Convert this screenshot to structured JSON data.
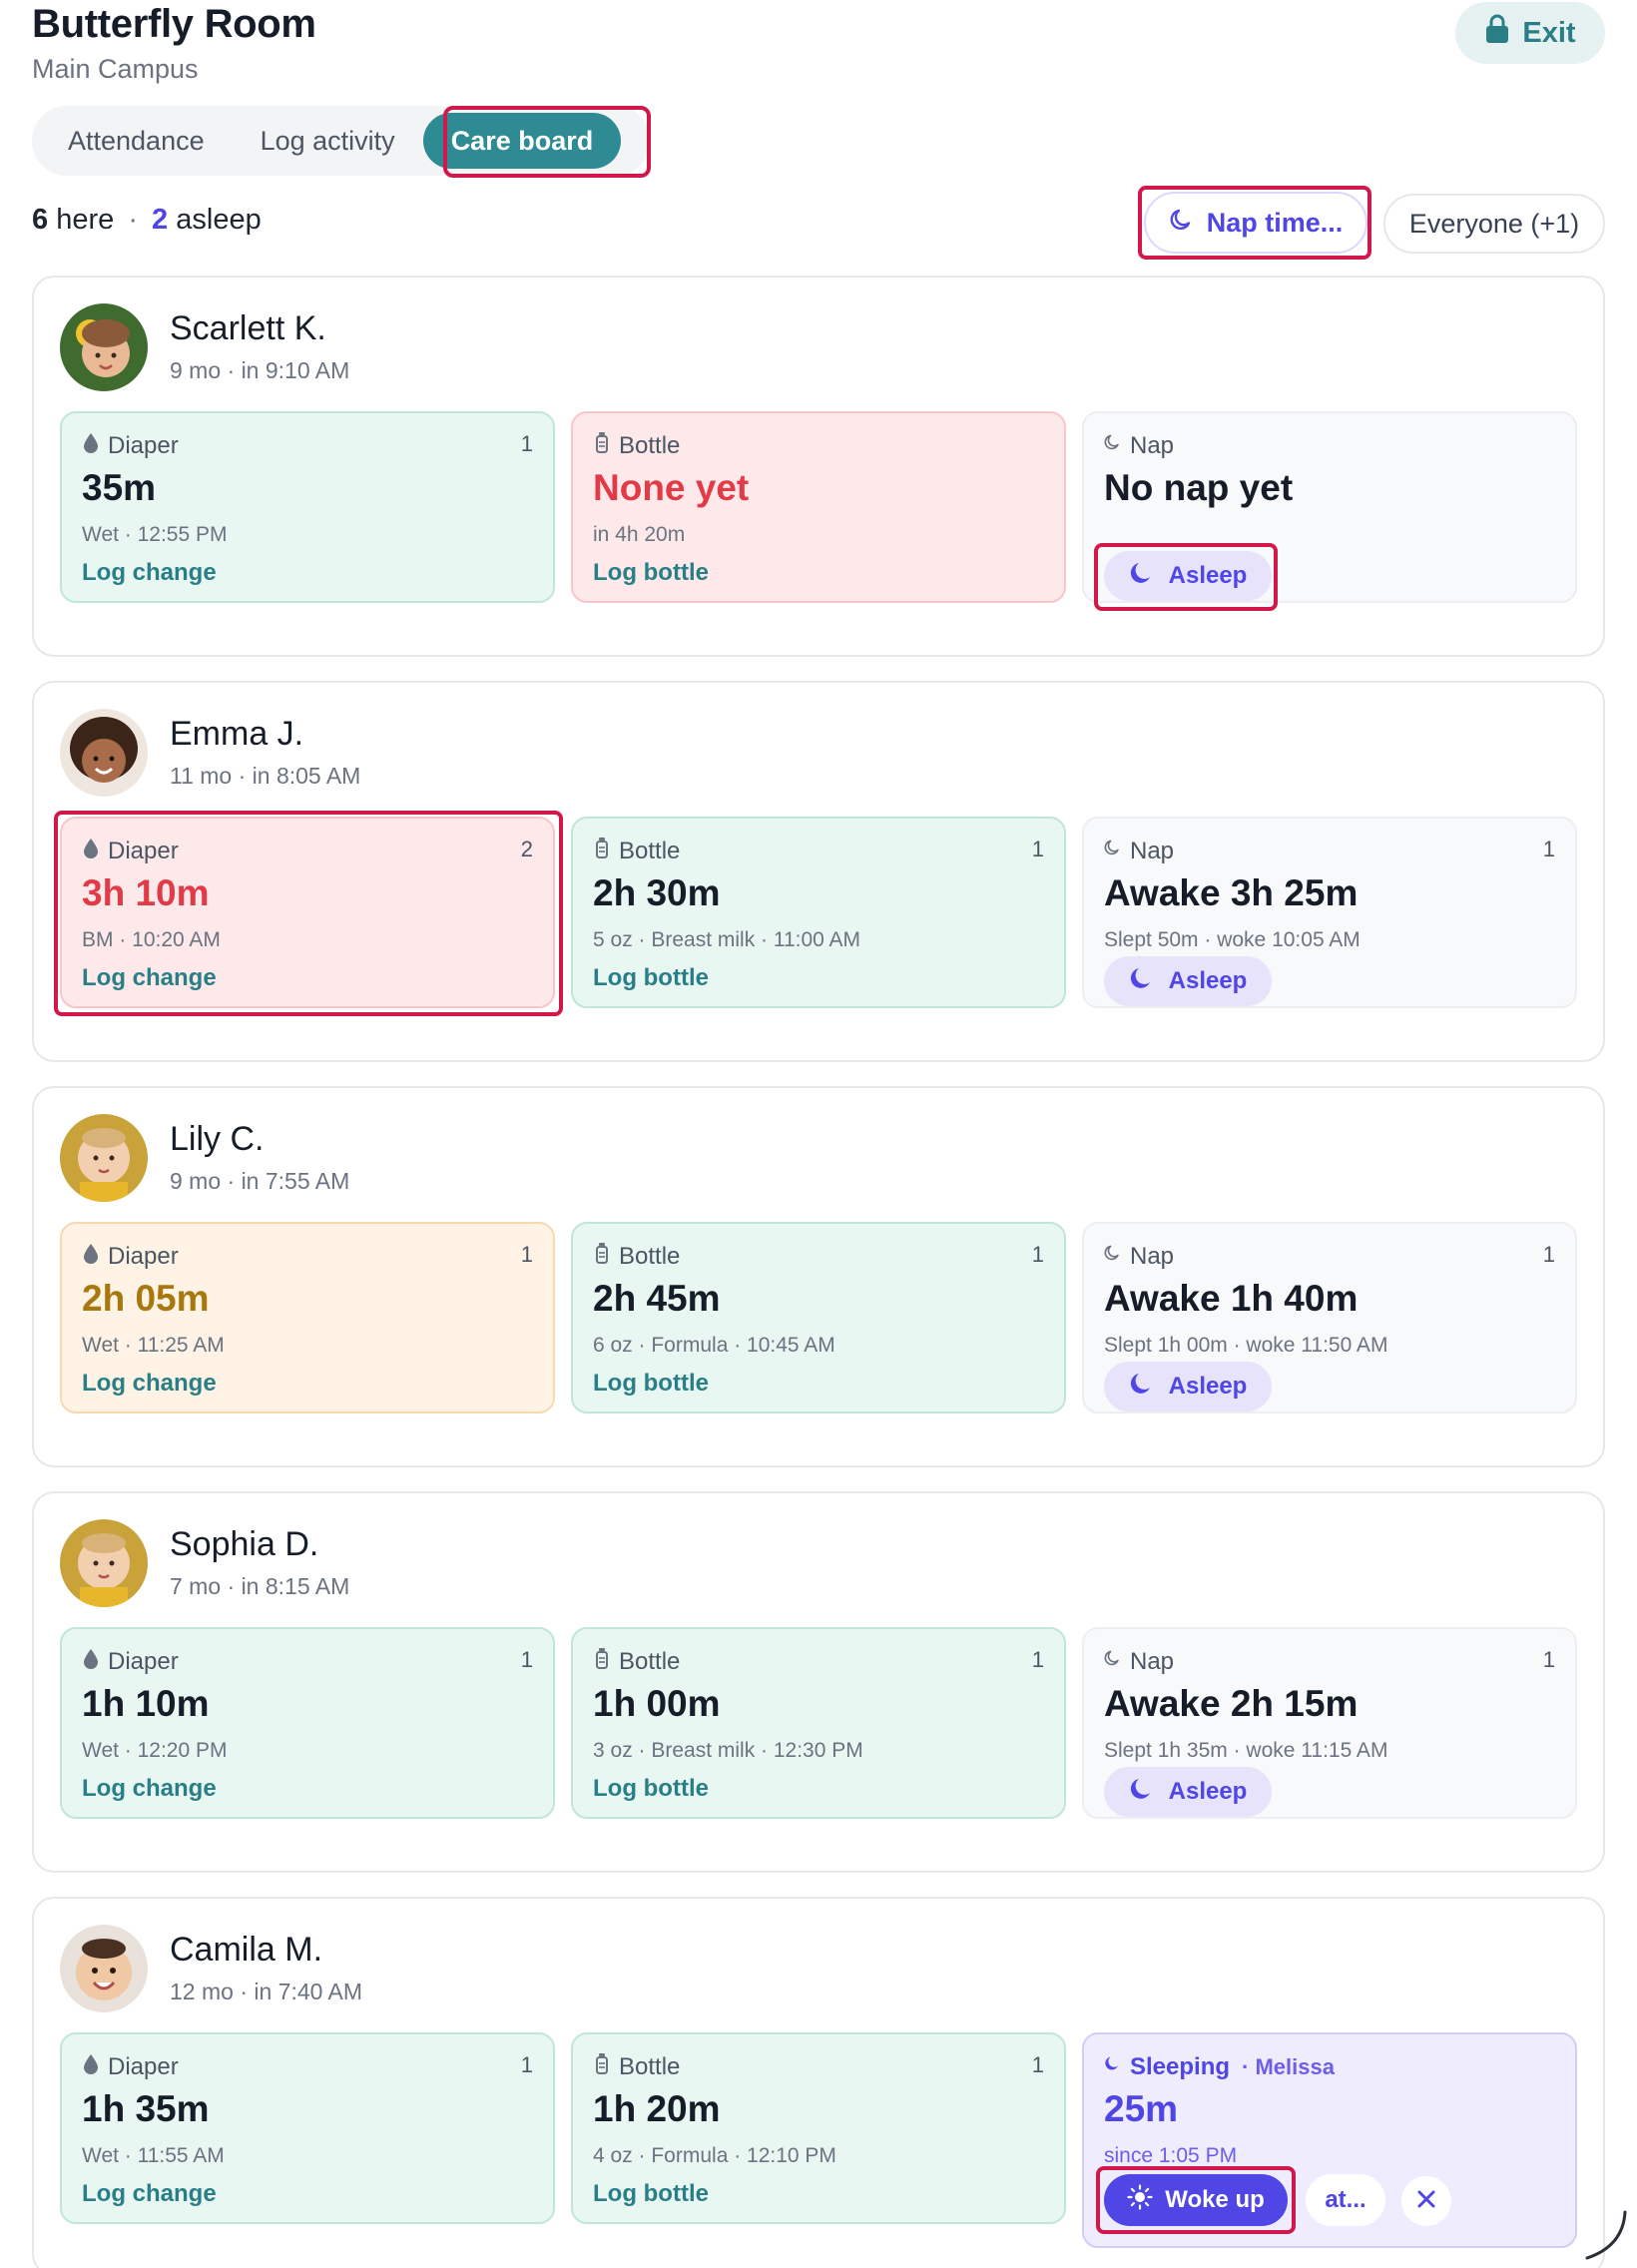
{
  "header": {
    "room_title": "Butterfly Room",
    "campus": "Main Campus",
    "exit_label": "Exit"
  },
  "tabs": [
    {
      "label": "Attendance",
      "active": false
    },
    {
      "label": "Log activity",
      "active": false
    },
    {
      "label": "Care board",
      "active": true
    }
  ],
  "summary": {
    "here_count": "6",
    "here_label": "here",
    "separator": "·",
    "asleep_count": "2",
    "asleep_label": "asleep"
  },
  "filters": {
    "nap_time_label": "Nap time...",
    "everyone_label": "Everyone (+1)"
  },
  "colors": {
    "accent_teal": "#2e8b93",
    "accent_violet": "#4f46e5",
    "alert_red": "#e23b47",
    "warn_amber": "#a8780f",
    "highlight_red": "#d0194a"
  },
  "children": [
    {
      "name": "Scarlett K.",
      "meta": "9 mo · in 9:10 AM",
      "diaper": {
        "label": "Diaper",
        "count": "1",
        "value": "35m",
        "detail": "Wet · 12:55 PM",
        "action": "Log change",
        "status": "ok"
      },
      "bottle": {
        "label": "Bottle",
        "count": "",
        "value": "None yet",
        "detail": "in 4h 20m",
        "action": "Log bottle",
        "status": "alert"
      },
      "nap": {
        "label": "Nap",
        "count": "",
        "value": "No nap yet",
        "detail": "",
        "action": "Asleep",
        "status": "neutral"
      }
    },
    {
      "name": "Emma J.",
      "meta": "11 mo · in 8:05 AM",
      "diaper": {
        "label": "Diaper",
        "count": "2",
        "value": "3h 10m",
        "detail": "BM · 10:20 AM",
        "action": "Log change",
        "status": "alert"
      },
      "bottle": {
        "label": "Bottle",
        "count": "1",
        "value": "2h 30m",
        "detail": "5 oz · Breast milk · 11:00 AM",
        "action": "Log bottle",
        "status": "ok"
      },
      "nap": {
        "label": "Nap",
        "count": "1",
        "value": "Awake 3h 25m",
        "detail": "Slept 50m · woke 10:05 AM",
        "action": "Asleep",
        "status": "neutral"
      }
    },
    {
      "name": "Lily C.",
      "meta": "9 mo · in 7:55 AM",
      "diaper": {
        "label": "Diaper",
        "count": "1",
        "value": "2h 05m",
        "detail": "Wet · 11:25 AM",
        "action": "Log change",
        "status": "warn"
      },
      "bottle": {
        "label": "Bottle",
        "count": "1",
        "value": "2h 45m",
        "detail": "6 oz · Formula · 10:45 AM",
        "action": "Log bottle",
        "status": "ok"
      },
      "nap": {
        "label": "Nap",
        "count": "1",
        "value": "Awake 1h 40m",
        "detail": "Slept 1h 00m · woke 11:50 AM",
        "action": "Asleep",
        "status": "neutral"
      }
    },
    {
      "name": "Sophia D.",
      "meta": "7 mo · in 8:15 AM",
      "diaper": {
        "label": "Diaper",
        "count": "1",
        "value": "1h 10m",
        "detail": "Wet · 12:20 PM",
        "action": "Log change",
        "status": "ok"
      },
      "bottle": {
        "label": "Bottle",
        "count": "1",
        "value": "1h 00m",
        "detail": "3 oz · Breast milk · 12:30 PM",
        "action": "Log bottle",
        "status": "ok"
      },
      "nap": {
        "label": "Nap",
        "count": "1",
        "value": "Awake 2h 15m",
        "detail": "Slept 1h 35m · woke 11:15 AM",
        "action": "Asleep",
        "status": "neutral"
      }
    },
    {
      "name": "Camila M.",
      "meta": "12 mo · in 7:40 AM",
      "diaper": {
        "label": "Diaper",
        "count": "1",
        "value": "1h 35m",
        "detail": "Wet · 11:55 AM",
        "action": "Log change",
        "status": "ok"
      },
      "bottle": {
        "label": "Bottle",
        "count": "1",
        "value": "1h 20m",
        "detail": "4 oz · Formula · 12:10 PM",
        "action": "Log bottle",
        "status": "ok"
      },
      "nap": {
        "label": "Sleeping",
        "by": "· Melissa",
        "count": "",
        "value": "25m",
        "detail": "since 1:05 PM",
        "action": "Woke up",
        "at_label": "at...",
        "status": "sleeping"
      }
    }
  ]
}
